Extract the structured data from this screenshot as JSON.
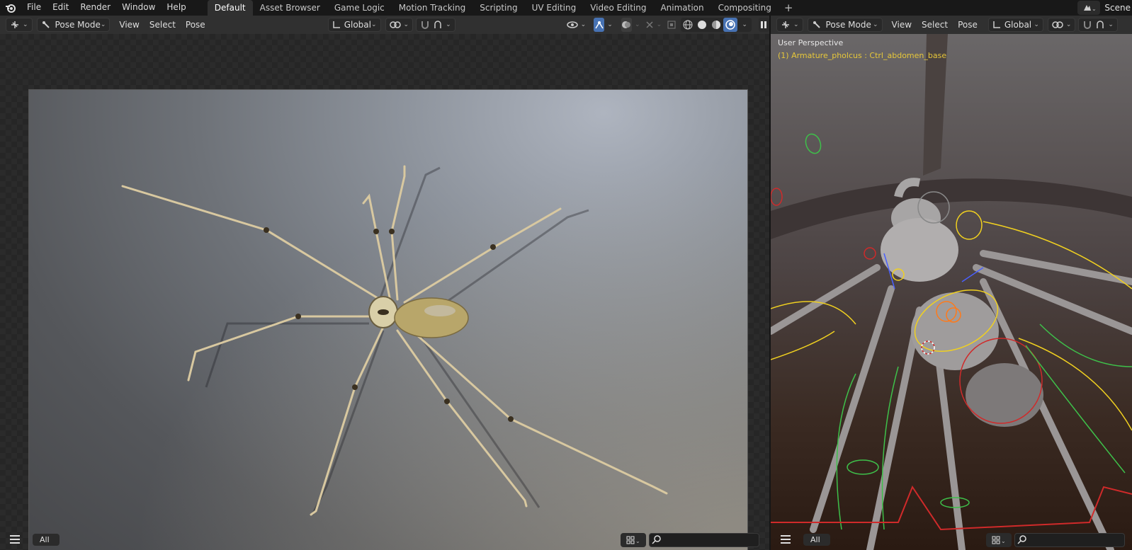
{
  "topbar": {
    "menu": [
      "File",
      "Edit",
      "Render",
      "Window",
      "Help"
    ],
    "workspaces": [
      "Default",
      "Asset Browser",
      "Game Logic",
      "Motion Tracking",
      "Scripting",
      "UV Editing",
      "Video Editing",
      "Animation",
      "Compositing"
    ],
    "active_workspace": "Default",
    "add_tab": "+",
    "scene_label": "Scene"
  },
  "left_editor": {
    "header": {
      "mode": "Pose Mode",
      "menus": [
        "View",
        "Select",
        "Pose"
      ],
      "orientation": "Global"
    },
    "bottom": {
      "collection_filter": "All",
      "search_value": ""
    }
  },
  "right_editor": {
    "header": {
      "mode": "Pose Mode",
      "menus": [
        "View",
        "Select",
        "Pose"
      ],
      "orientation": "Global"
    },
    "overlay": {
      "perspective": "User Perspective",
      "active_object": "(1) Armature_pholcus : Ctrl_abdomen_base"
    },
    "bottom": {
      "collection_filter": "All",
      "search_value": ""
    }
  },
  "colors": {
    "accent_blue": "#4772b3",
    "overlay_yellow": "#e7c73a",
    "bone_yellow": "#f0d020",
    "bone_green": "#3ec04a",
    "bone_red": "#d02a2a",
    "bone_orange": "#ff7a1a",
    "bone_blue": "#4a60ff"
  }
}
